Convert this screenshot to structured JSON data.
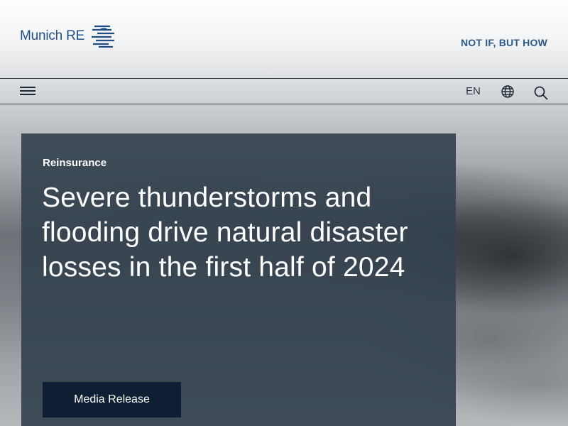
{
  "header": {
    "logo_text": "Munich RE",
    "claim": "NOT IF, BUT HOW"
  },
  "navbar": {
    "menu_icon": "hamburger-menu-icon",
    "language": "EN",
    "globe_icon": "globe-icon",
    "search_icon": "search-icon"
  },
  "hero": {
    "category": "Reinsurance",
    "headline": "Severe thunderstorms and flooding drive natural disaster losses in the first half of 2024",
    "cta_label": "Media Release"
  },
  "colors": {
    "brand_blue": "#1f4f86",
    "card_bg": "#35434f",
    "cta_bg": "#0f1f33"
  }
}
